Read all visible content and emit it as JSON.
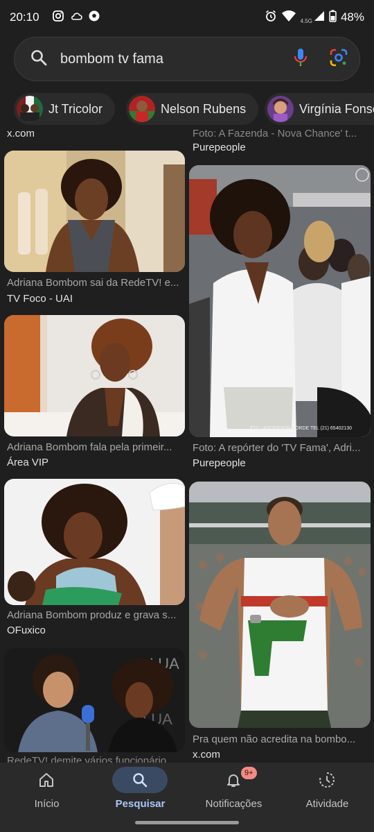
{
  "status": {
    "time": "20:10",
    "network": "4.5G",
    "battery": "48%"
  },
  "search": {
    "query": "bombom tv fama"
  },
  "chips": [
    {
      "label": "Jt Tricolor"
    },
    {
      "label": "Nelson Rubens"
    },
    {
      "label": "Virgínia Fonse"
    }
  ],
  "results": {
    "top_left": {
      "source": "x.com"
    },
    "top_right": {
      "caption": "Foto: A Fazenda - Nova Chance' t...",
      "source": "Purepeople"
    },
    "left": [
      {
        "caption": "Adriana Bombom sai da RedeTV! e...",
        "source": "TV Foco - UAI"
      },
      {
        "caption": "Adriana Bombom fala pela primeir...",
        "source": "Área VIP"
      },
      {
        "caption": "Adriana Bombom produz e grava s...",
        "source": "OFuxico"
      },
      {
        "caption": "RedeTV! demite vários funcionário..."
      }
    ],
    "right": [
      {
        "caption": "Foto: A repórter do 'TV Fama', Adri...",
        "source": "Purepeople",
        "watermark": "FTS / ANDERSON BORDE TEL (21) 65402130"
      },
      {
        "caption": "Pra quem não acredita na bombo...",
        "source": "x.com"
      }
    ]
  },
  "nav": {
    "items": [
      {
        "label": "Início"
      },
      {
        "label": "Pesquisar"
      },
      {
        "label": "Notificações",
        "badge": "9+"
      },
      {
        "label": "Atividade"
      }
    ]
  },
  "colors": {
    "background": "#1f1f1f",
    "accent": "#a8c7fa",
    "badge": "#f28b82"
  }
}
